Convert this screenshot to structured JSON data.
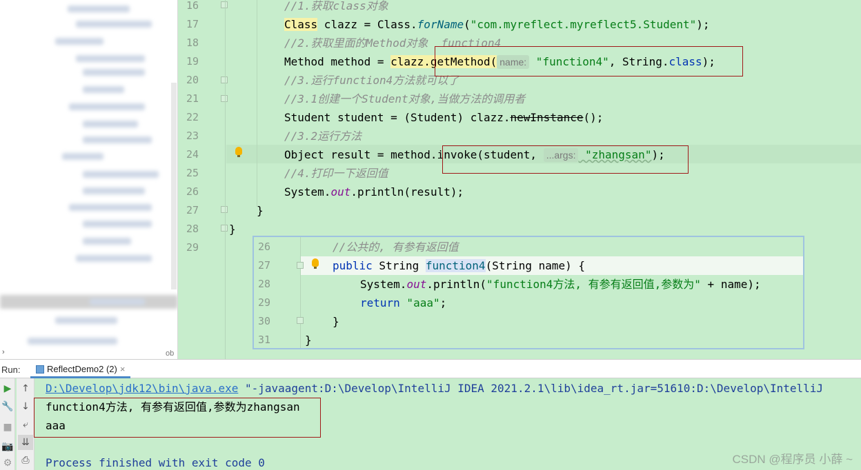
{
  "editor": {
    "lines": [
      {
        "num": "16",
        "text": "//1.获取class对象"
      },
      {
        "num": "17",
        "parts": [
          "Class",
          " clazz = Class.",
          "forName",
          "(",
          "\"com.myreflect.myreflect5.Student\"",
          ");"
        ]
      },
      {
        "num": "18",
        "text": "//2.获取里面的Method对象  function4"
      },
      {
        "num": "19",
        "parts": [
          "Method method = ",
          "clazz.",
          "getMethod(",
          "name:",
          " \"function4\"",
          ", String.",
          "class",
          ");"
        ]
      },
      {
        "num": "20",
        "text": "//3.运行function4方法就可以了"
      },
      {
        "num": "21",
        "text": "//3.1创建一个Student对象,当做方法的调用者"
      },
      {
        "num": "22",
        "parts": [
          "Student student = (Student) clazz.",
          "newInstance",
          "();"
        ]
      },
      {
        "num": "23",
        "text": "//3.2运行方法"
      },
      {
        "num": "24",
        "parts": [
          "Object result = method.",
          "invoke(student, ",
          "...args:",
          " \"zhangsan\"",
          ");"
        ]
      },
      {
        "num": "25",
        "text": "//4.打印一下返回值"
      },
      {
        "num": "26",
        "parts": [
          "System.",
          "out",
          ".println(result);"
        ]
      },
      {
        "num": "27",
        "text": "}"
      },
      {
        "num": "28",
        "text": "}"
      },
      {
        "num": "29",
        "text": ""
      }
    ]
  },
  "popup": {
    "lines": [
      {
        "num": "26",
        "text": "//公共的, 有参有返回值"
      },
      {
        "num": "27",
        "parts": [
          "public",
          " String ",
          "function4",
          "(String name) {"
        ]
      },
      {
        "num": "28",
        "parts": [
          "System.",
          "out",
          ".println(",
          "\"function4方法, 有参有返回值,参数为\"",
          " + name);"
        ]
      },
      {
        "num": "29",
        "parts": [
          "return",
          " \"aaa\"",
          ";"
        ]
      },
      {
        "num": "30",
        "text": "}"
      },
      {
        "num": "31",
        "text": "}"
      }
    ]
  },
  "run": {
    "label": "Run:",
    "tab": "ReflectDemo2 (2)",
    "tab_close": "×",
    "console": {
      "cmd_path": "D:\\Develop\\jdk12\\bin\\java.exe",
      "cmd_args": " \"-javaagent:D:\\Develop\\IntelliJ IDEA 2021.2.1\\lib\\idea_rt.jar=51610:D:\\Develop\\IntelliJ ",
      "out1": "function4方法, 有参有返回值,参数为zhangsan",
      "out2": "aaa",
      "finish": "Process finished with exit code 0"
    }
  },
  "sidebar": {
    "truncated_label": "ob"
  },
  "watermark": "CSDN @程序员 小薛 ~"
}
